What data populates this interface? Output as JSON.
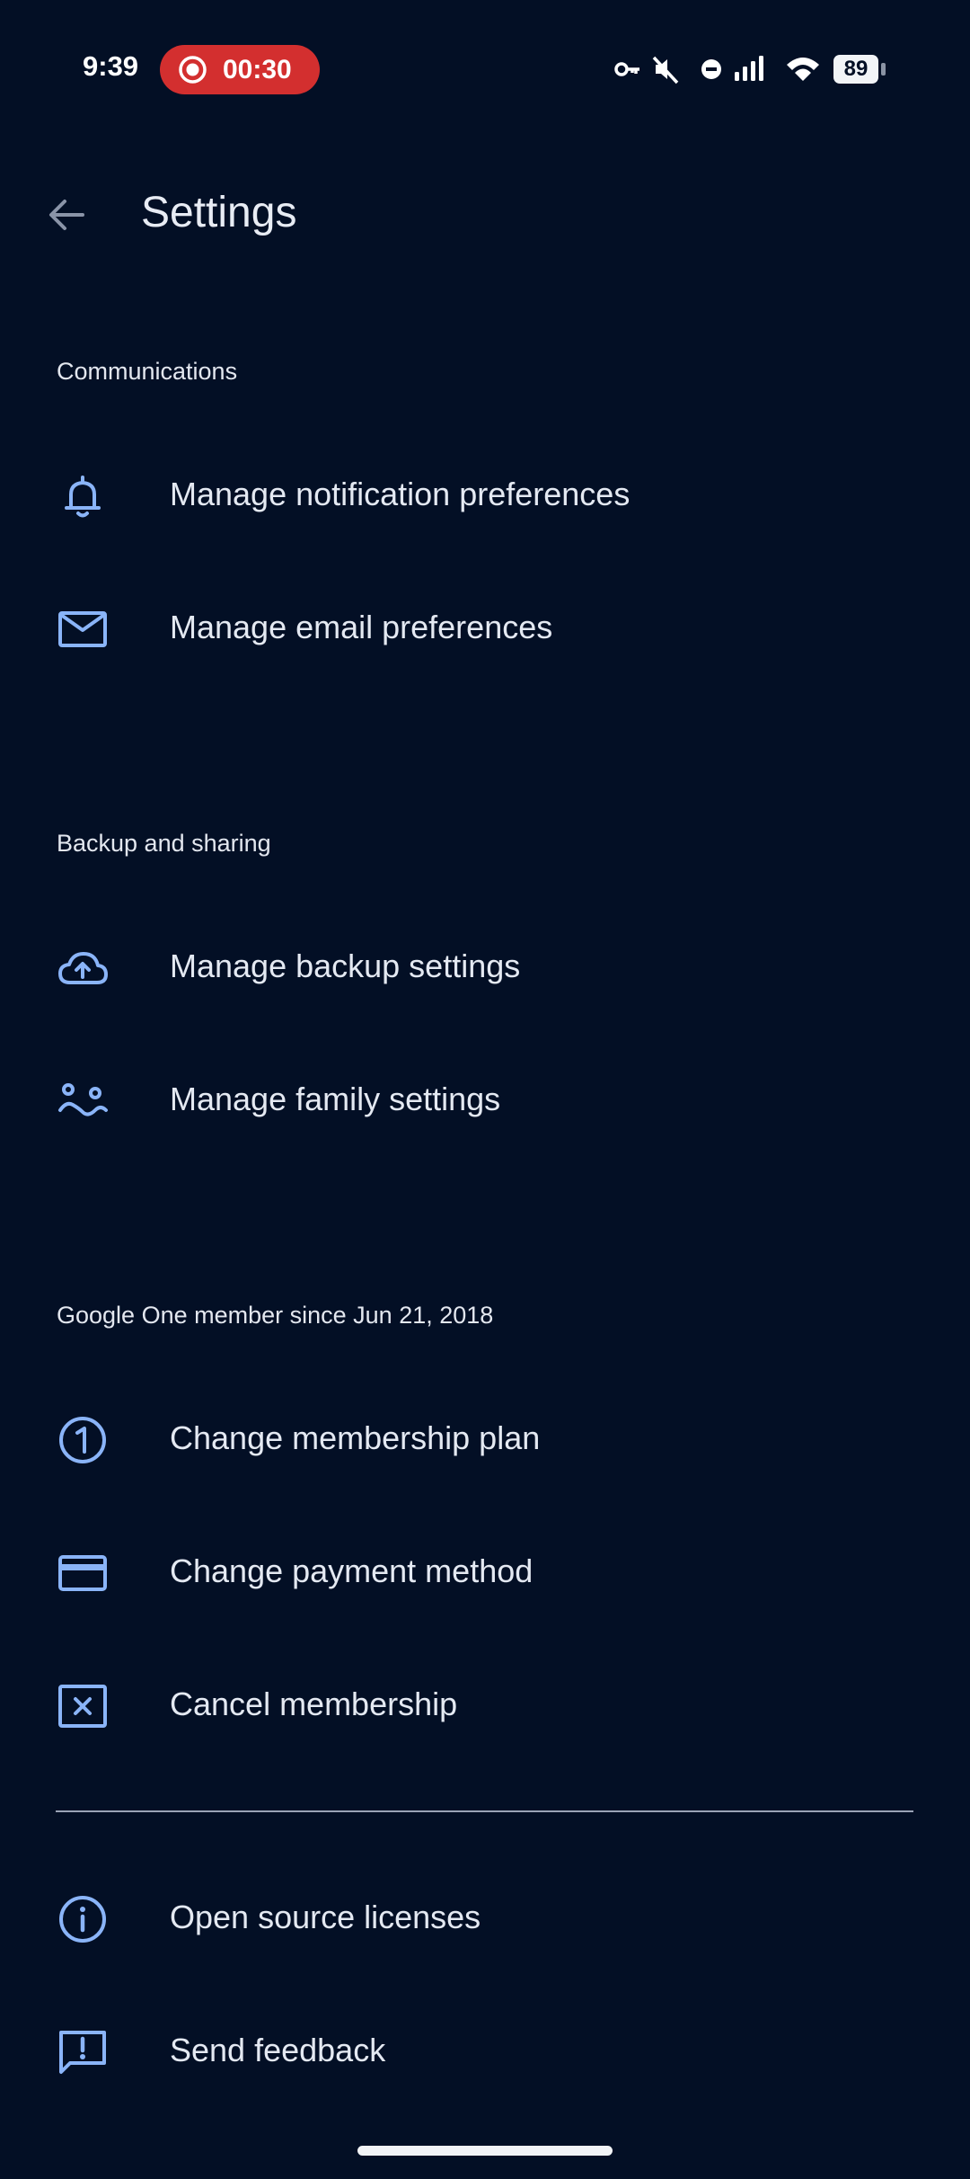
{
  "status_bar": {
    "time": "9:39",
    "recording_time": "00:30",
    "battery": "89",
    "recording_color": "#d32f2f"
  },
  "app_bar": {
    "title": "Settings",
    "back_icon": "arrow-back-icon"
  },
  "sections": [
    {
      "header": "Communications",
      "items": [
        {
          "label": "Manage notification preferences",
          "icon": "bell-icon"
        },
        {
          "label": "Manage email preferences",
          "icon": "mail-icon"
        }
      ]
    },
    {
      "header": "Backup and sharing",
      "items": [
        {
          "label": "Manage backup settings",
          "icon": "cloud-upload-icon"
        },
        {
          "label": "Manage family settings",
          "icon": "family-icon"
        }
      ]
    },
    {
      "header": "Google One member since Jun 21, 2018",
      "items": [
        {
          "label": "Change membership plan",
          "icon": "google-one-icon"
        },
        {
          "label": "Change payment method",
          "icon": "credit-card-icon"
        },
        {
          "label": "Cancel membership",
          "icon": "cancel-box-icon"
        }
      ]
    },
    {
      "header": "",
      "items": [
        {
          "label": "Open source licenses",
          "icon": "info-icon"
        },
        {
          "label": "Send feedback",
          "icon": "feedback-icon"
        }
      ]
    }
  ],
  "colors": {
    "background": "#030f25",
    "icon_accent": "#8ab4f8",
    "text": "#e4e9f2"
  }
}
